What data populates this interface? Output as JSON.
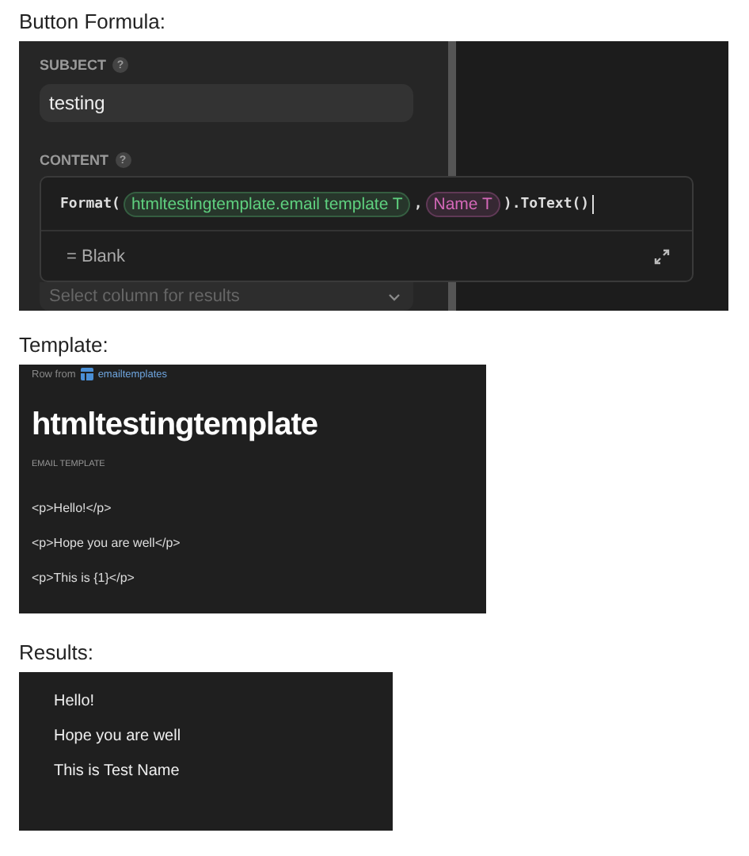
{
  "button_formula": {
    "heading": "Button Formula:",
    "subject": {
      "label": "SUBJECT",
      "help": "?",
      "value": "testing"
    },
    "content": {
      "label": "CONTENT",
      "help": "?"
    },
    "formula": [
      {
        "kind": "code",
        "text": "Format("
      },
      {
        "kind": "token",
        "text": "htmltestingtemplate.email template",
        "type": "T",
        "color": "#5fd07f"
      },
      {
        "kind": "code",
        "text": ","
      },
      {
        "kind": "token",
        "text": "Name",
        "type": "T",
        "color": "#d468b8"
      },
      {
        "kind": "code",
        "text": ").ToText()"
      }
    ],
    "result": "= Blank",
    "results_column": {
      "placeholder": "Select column for results"
    }
  },
  "template": {
    "heading": "Template:",
    "source_prefix": "Row from",
    "source_table": "emailtemplates",
    "title": "htmltestingtemplate",
    "field_label": "EMAIL TEMPLATE",
    "lines": [
      "<p>Hello!</p>",
      "<p>Hope you are well</p>",
      "<p>This is {1}</p>"
    ]
  },
  "results": {
    "heading": "Results:",
    "lines": [
      "Hello!",
      "Hope you are well",
      "This is Test Name"
    ]
  }
}
